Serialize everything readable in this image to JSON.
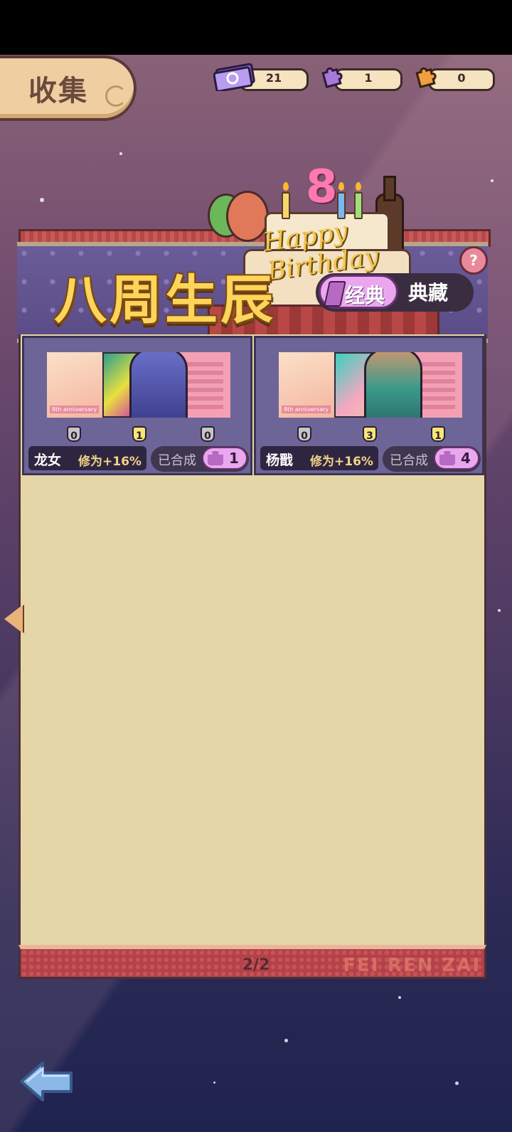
{
  "header": {
    "title": "收集"
  },
  "currencies": [
    {
      "icon": "ticket-icon",
      "value": "21"
    },
    {
      "icon": "purple-puzzle-icon",
      "value": "1"
    },
    {
      "icon": "orange-puzzle-icon",
      "value": "0"
    }
  ],
  "event": {
    "title": "八周生辰",
    "cake_text": "Happy Birthday",
    "cake_number": "8",
    "toggle": {
      "active": "经典",
      "inactive": "典藏"
    },
    "help": "?"
  },
  "cards": [
    {
      "name": "龙女",
      "bonus": "修为+16%",
      "tags": [
        "0",
        "1",
        "0"
      ],
      "combined_label": "已合成",
      "combined_count": "1",
      "anniversary": "8th anniversary"
    },
    {
      "name": "杨戬",
      "bonus": "修为+16%",
      "tags": [
        "0",
        "3",
        "1"
      ],
      "combined_label": "已合成",
      "combined_count": "4",
      "anniversary": "8th anniversary"
    }
  ],
  "footer": {
    "page": "2/2",
    "watermark": "FEI REN ZAI"
  }
}
